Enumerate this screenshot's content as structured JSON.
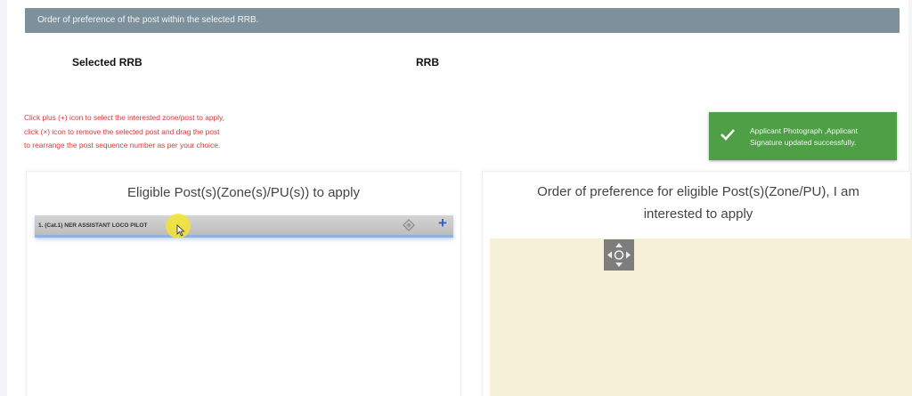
{
  "header": {
    "text": "Order of preference of the post within the selected RRB."
  },
  "labels": {
    "selected_rrb": "Selected RRB",
    "rrb": "RRB"
  },
  "instructions": [
    "Click plus (+) icon to select the interested zone/post to apply,",
    "click (×) icon to remove the selected post and drag the post",
    "to rearrange the post sequence number as per your choice."
  ],
  "toast": {
    "line1": "Applicant Photograph ,Applicant",
    "line2": "Signature updated successfully.",
    "icon": "check-icon",
    "color": "#4f9f46"
  },
  "eligible_panel": {
    "title": "Eligible Post(s)(Zone(s)/PU(s)) to apply",
    "items": [
      {
        "label": "1. (Cat.1) NER ASSISTANT LOCO PILOT",
        "drag_icon": "drag-handle-icon",
        "add_icon": "plus-icon"
      }
    ]
  },
  "preference_panel": {
    "title": "Order of preference for eligible Post(s)(Zone/PU), I am interested to apply",
    "drop_area_color": "#f8f1da",
    "move_icon": "move-arrows-icon"
  },
  "colors": {
    "header_bg": "#7d919c",
    "instruction_text": "#d23a3a",
    "plus": "#2e62c0"
  }
}
